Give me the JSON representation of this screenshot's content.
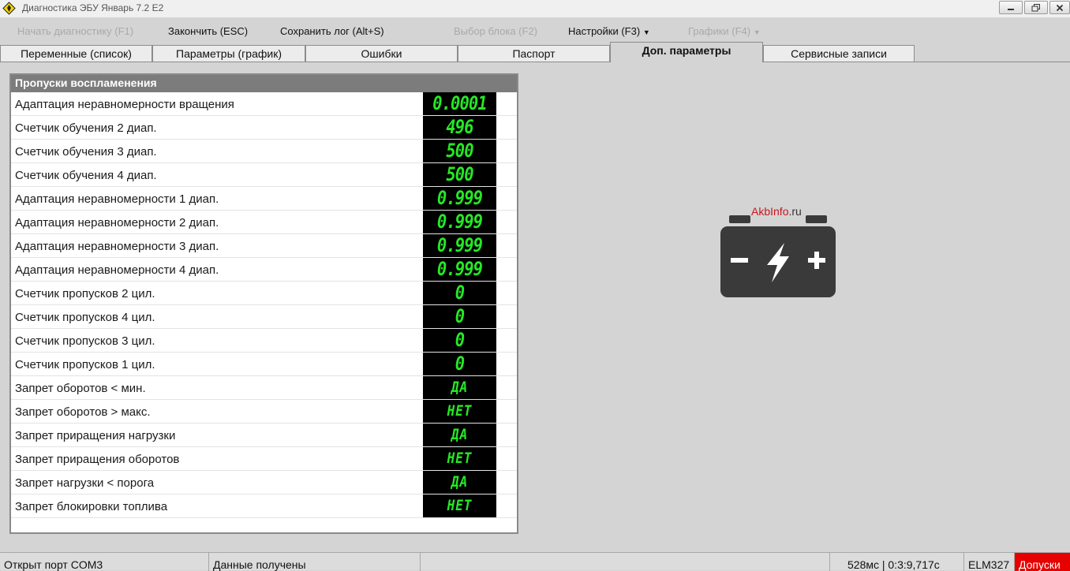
{
  "window": {
    "title": "Диагностика ЭБУ Январь 7.2 E2"
  },
  "menu": [
    {
      "label": "Начать диагностику (F1)",
      "enabled": false
    },
    {
      "label": "Закончить (ESC)",
      "enabled": true
    },
    {
      "label": "Сохранить лог (Alt+S)",
      "enabled": true
    },
    {
      "label": "Выбор блока (F2)",
      "enabled": false
    },
    {
      "label": "Настройки (F3)",
      "enabled": true,
      "dropdown": true
    },
    {
      "label": "Графики (F4)",
      "enabled": false,
      "dropdown": true
    }
  ],
  "tabs": [
    {
      "label": "Переменные (список)",
      "active": false
    },
    {
      "label": "Параметры (график)",
      "active": false
    },
    {
      "label": "Ошибки",
      "active": false
    },
    {
      "label": "Паспорт",
      "active": false
    },
    {
      "label": "Доп. параметры",
      "active": true
    },
    {
      "label": "Сервисные записи",
      "active": false
    }
  ],
  "panel": {
    "title": "Пропуски воспламенения",
    "rows": [
      {
        "label": "Адаптация неравномерности вращения",
        "value": "0.0001"
      },
      {
        "label": "Счетчик обучения 2 диап.",
        "value": "496"
      },
      {
        "label": "Счетчик обучения 3 диап.",
        "value": "500"
      },
      {
        "label": "Счетчик обучения 4 диап.",
        "value": "500"
      },
      {
        "label": "Адаптация неравномерности 1 диап.",
        "value": "0.999"
      },
      {
        "label": "Адаптация неравномерности 2 диап.",
        "value": "0.999"
      },
      {
        "label": "Адаптация неравномерности 3 диап.",
        "value": "0.999"
      },
      {
        "label": "Адаптация неравномерности 4 диап.",
        "value": "0.999"
      },
      {
        "label": "Счетчик пропусков 2 цил.",
        "value": "0"
      },
      {
        "label": "Счетчик пропусков 4 цил.",
        "value": "0"
      },
      {
        "label": "Счетчик пропусков 3 цил.",
        "value": "0"
      },
      {
        "label": "Счетчик пропусков 1 цил.",
        "value": "0"
      },
      {
        "label": "Запрет оборотов < мин.",
        "value": "ДА"
      },
      {
        "label": "Запрет оборотов > макс.",
        "value": "НЕТ"
      },
      {
        "label": "Запрет приращения нагрузки",
        "value": "ДА"
      },
      {
        "label": "Запрет приращения оборотов",
        "value": "НЕТ"
      },
      {
        "label": "Запрет нагрузки < порога",
        "value": "ДА"
      },
      {
        "label": "Запрет блокировки топлива",
        "value": "НЕТ"
      }
    ]
  },
  "watermark": {
    "brand": "AkbInfo",
    "tld": ".ru",
    "icon": "car-battery-icon"
  },
  "status": {
    "port": "Открыт порт COM3",
    "data": "Данные получены",
    "empty": "",
    "timing": "528мс | 0:3:9,717с",
    "adapter": "ELM327",
    "alert": "Допуски"
  },
  "colors": {
    "lcd_text": "#25e825",
    "lcd_bg": "#000000",
    "panel_header": "#7c7c7c",
    "alert": "#e60000",
    "brand_red": "#c8161d"
  }
}
